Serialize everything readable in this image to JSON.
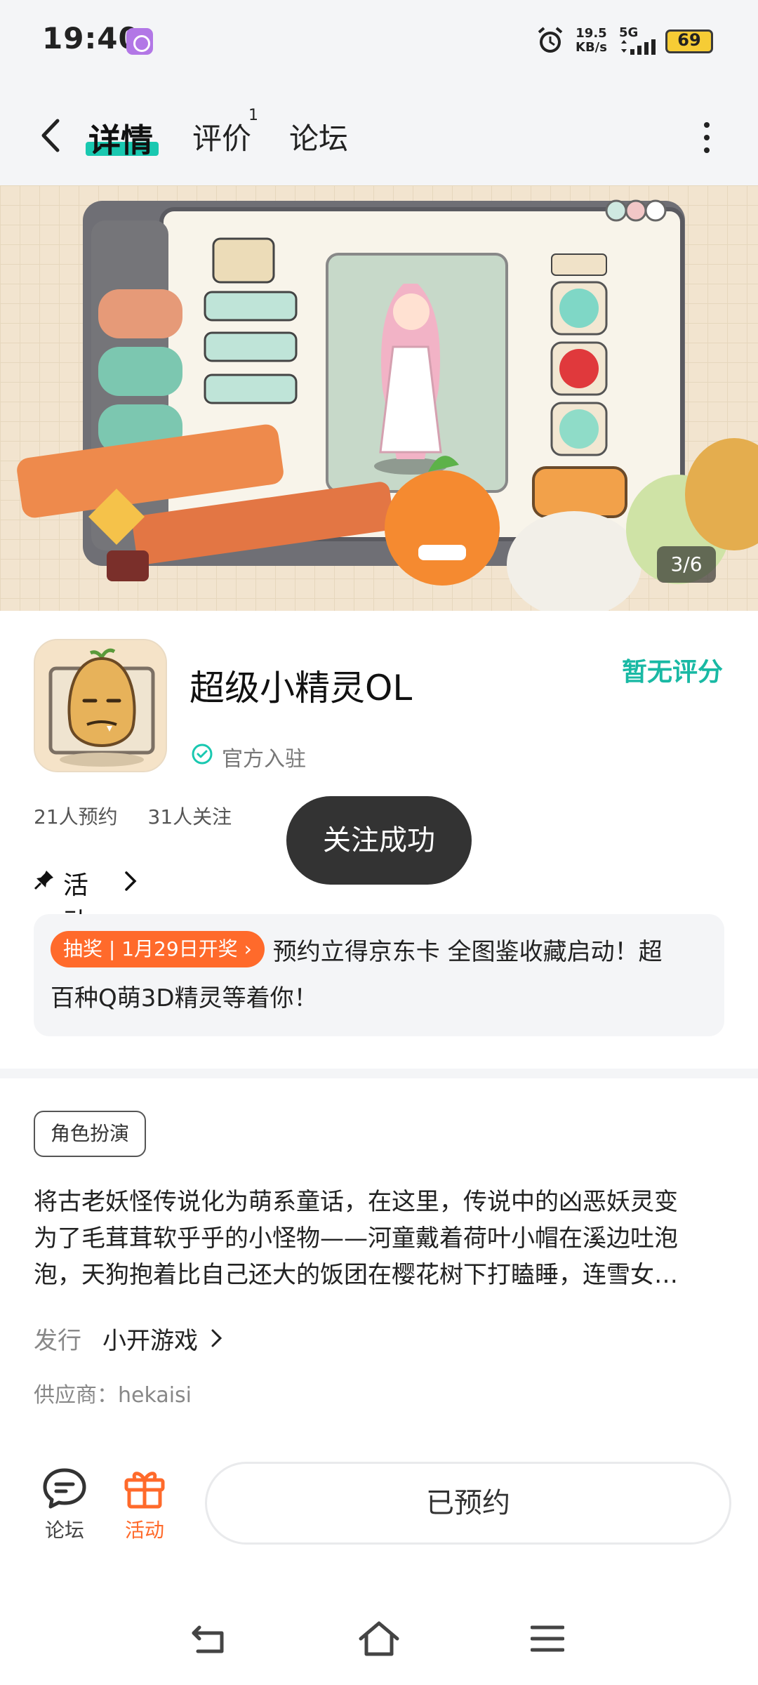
{
  "status_bar": {
    "time": "19:40",
    "speed_value": "19.5",
    "speed_unit": "KB/s",
    "network": "5G",
    "battery": "69"
  },
  "header": {
    "tabs": [
      {
        "label": "详情",
        "active": true
      },
      {
        "label": "评价",
        "badge": "1"
      },
      {
        "label": "论坛"
      }
    ]
  },
  "banner": {
    "counter": "3/6"
  },
  "app": {
    "name": "超级小精灵OL",
    "rating": "暂无评分",
    "official_badge": "官方入驻",
    "reservations": "21人预约",
    "followers": "31人关注"
  },
  "toast": "关注成功",
  "activity": {
    "label": "活动",
    "promo_tag": "抽奖 | 1月29日开奖 ›",
    "promo_line1": "预约立得京东卡 全图鉴收藏启动！超",
    "promo_line2": "百种Q萌3D精灵等着你！"
  },
  "detail": {
    "genre": "角色扮演",
    "description_lines": [
      "将古老妖怪传说化为萌系童话，在这里，传说中的凶恶妖灵变",
      "为了毛茸茸软乎乎的小怪物——河童戴着荷叶小帽在溪边吐泡",
      "泡，天狗抱着比自己还大的饭团在樱花树下打瞌睡，连雪女…"
    ],
    "publisher_key": "发行",
    "publisher_value": "小开游戏",
    "supplier": "供应商：hekaisi"
  },
  "bottom_bar": {
    "forum_label": "论坛",
    "activity_label": "活动",
    "reserved_label": "已预约"
  },
  "colors": {
    "accent": "#19c8b0",
    "orange": "#ff6a2b",
    "background": "#f4f5f7"
  }
}
